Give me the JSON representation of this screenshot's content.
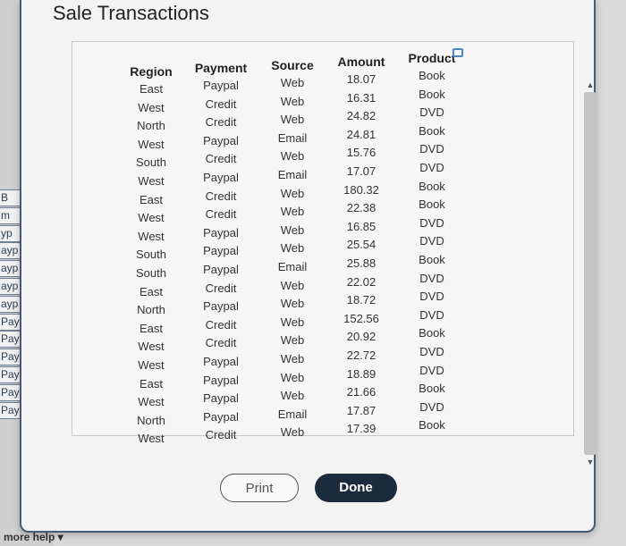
{
  "window": {
    "title": "Sale Transactions"
  },
  "background": {
    "peek_cells": [
      "B",
      "m",
      "yp",
      "ayp",
      "ayp",
      "ayp",
      "ayp",
      "Payp",
      "Payp",
      "Payp",
      "Payp",
      "Payp",
      "Payp"
    ],
    "more_help_label": "more help ▾"
  },
  "table": {
    "headers": [
      "Region",
      "Payment",
      "Source",
      "Amount",
      "Product"
    ],
    "rows": [
      [
        "East",
        "Paypal",
        "Web",
        "18.07",
        "Book"
      ],
      [
        "West",
        "Credit",
        "Web",
        "16.31",
        "Book"
      ],
      [
        "North",
        "Credit",
        "Web",
        "24.82",
        "DVD"
      ],
      [
        "West",
        "Paypal",
        "Email",
        "24.81",
        "Book"
      ],
      [
        "South",
        "Credit",
        "Web",
        "15.76",
        "DVD"
      ],
      [
        "West",
        "Paypal",
        "Email",
        "17.07",
        "DVD"
      ],
      [
        "East",
        "Credit",
        "Web",
        "180.32",
        "Book"
      ],
      [
        "West",
        "Credit",
        "Web",
        "22.38",
        "Book"
      ],
      [
        "West",
        "Paypal",
        "Web",
        "16.85",
        "DVD"
      ],
      [
        "South",
        "Paypal",
        "Web",
        "25.54",
        "DVD"
      ],
      [
        "South",
        "Paypal",
        "Email",
        "25.88",
        "Book"
      ],
      [
        "East",
        "Credit",
        "Web",
        "22.02",
        "DVD"
      ],
      [
        "North",
        "Paypal",
        "Web",
        "18.72",
        "DVD"
      ],
      [
        "East",
        "Credit",
        "Web",
        "152.56",
        "DVD"
      ],
      [
        "West",
        "Credit",
        "Web",
        "20.92",
        "Book"
      ],
      [
        "West",
        "Paypal",
        "Web",
        "22.72",
        "DVD"
      ],
      [
        "East",
        "Paypal",
        "Web",
        "18.89",
        "DVD"
      ],
      [
        "West",
        "Paypal",
        "Web",
        "21.66",
        "Book"
      ],
      [
        "North",
        "Paypal",
        "Email",
        "17.87",
        "DVD"
      ],
      [
        "West",
        "Credit",
        "Web",
        "17.39",
        "Book"
      ]
    ]
  },
  "icons": {
    "copy": "copy-icon",
    "scroll_up": "triangle-up-icon",
    "scroll_down": "triangle-down-icon"
  },
  "buttons": {
    "print_label": "Print",
    "done_label": "Done"
  },
  "colors": {
    "done_bg": "#1c2b3b",
    "copy_icon": "#4e88c6"
  }
}
